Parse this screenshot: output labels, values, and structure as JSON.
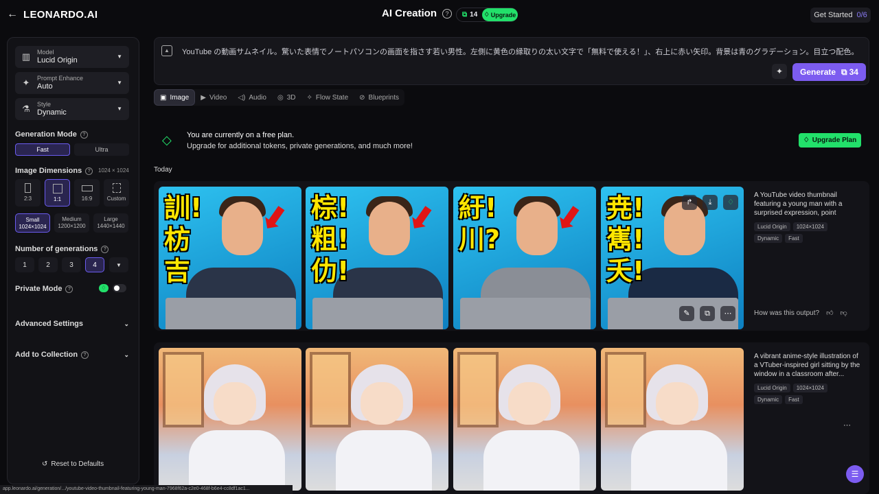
{
  "header": {
    "logo": "LEONARDO.AI",
    "title": "AI Creation",
    "tokens": "14",
    "upgrade": "Upgrade",
    "get_started": "Get Started",
    "get_started_count": "0/6"
  },
  "sidebar": {
    "model_label": "Model",
    "model_value": "Lucid Origin",
    "enhance_label": "Prompt Enhance",
    "enhance_value": "Auto",
    "style_label": "Style",
    "style_value": "Dynamic",
    "gen_mode_title": "Generation Mode",
    "mode_fast": "Fast",
    "mode_ultra": "Ultra",
    "dims_title": "Image Dimensions",
    "dims_value": "1024 × 1024",
    "ratios": [
      "2:3",
      "1:1",
      "16:9",
      "Custom"
    ],
    "sizes": [
      {
        "name": "Small",
        "dim": "1024×1024"
      },
      {
        "name": "Medium",
        "dim": "1200×1200"
      },
      {
        "name": "Large",
        "dim": "1440×1440"
      }
    ],
    "num_title": "Number of generations",
    "nums": [
      "1",
      "2",
      "3",
      "4"
    ],
    "private_title": "Private Mode",
    "advanced": "Advanced Settings",
    "collection": "Add to Collection",
    "reset": "Reset to Defaults"
  },
  "prompt": {
    "text": "YouTube の動画サムネイル。驚いた表情でノートパソコンの画面を指さす若い男性。左側に黄色の縁取りの太い文字で「無料で使える！」、右上に赤い矢印。背景は青のグラデーション。目立つ配色。",
    "generate": "Generate",
    "generate_cost": "34"
  },
  "tabs": [
    "Image",
    "Video",
    "Audio",
    "3D",
    "Flow State",
    "Blueprints"
  ],
  "banner": {
    "line1": "You are currently on a free plan.",
    "line2": "Upgrade for additional tokens, private generations, and much more!",
    "button": "Upgrade Plan"
  },
  "today": "Today",
  "generations": [
    {
      "desc": "A YouTube video thumbnail featuring a young man with a surprised expression, point",
      "tags": [
        "Lucid Origin",
        "1024×1024",
        "Dynamic",
        "Fast"
      ],
      "thumb_text": [
        "訓!枋吉",
        "棕!粗!仂!",
        "紆!川?",
        "尭!嶲!夭!"
      ]
    },
    {
      "desc": "A vibrant anime-style illustration of a VTuber-inspired girl sitting by the window in a classroom after...",
      "tags": [
        "Lucid Origin",
        "1024×1024",
        "Dynamic",
        "Fast"
      ]
    }
  ],
  "feedback": "How was this output?",
  "status_url": "app.leonardo.ai/generation/.../youtube-video-thumbnail-featuring-young-man-7968f62a-c2e0-468f-b6e4-cc8df1ac1..."
}
